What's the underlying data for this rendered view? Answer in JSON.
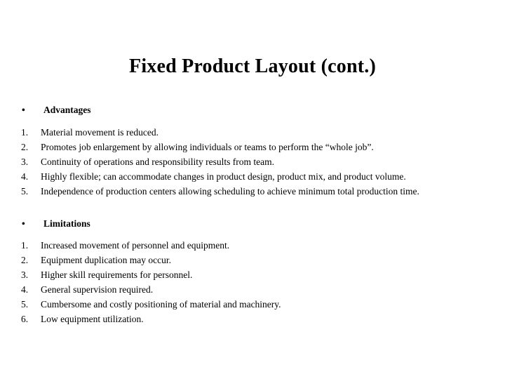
{
  "slide": {
    "title": "Fixed Product Layout (cont.)",
    "bullet_glyph": "•",
    "sections": [
      {
        "heading": "Advantages",
        "items": [
          {
            "number": "1.",
            "text": "Material movement is reduced."
          },
          {
            "number": "2.",
            "text": "Promotes job enlargement by allowing individuals or teams to perform the “whole job”."
          },
          {
            "number": "3.",
            "text": "Continuity of operations and responsibility results from team."
          },
          {
            "number": "4.",
            "text": "Highly flexible; can accommodate changes in product design, product mix, and product volume."
          },
          {
            "number": "5.",
            "text": "Independence of production centers allowing scheduling to achieve minimum total production time."
          }
        ]
      },
      {
        "heading": "Limitations",
        "items": [
          {
            "number": "1.",
            "text": "Increased movement of personnel and equipment."
          },
          {
            "number": "2.",
            "text": "Equipment duplication may occur."
          },
          {
            "number": "3.",
            "text": "Higher skill requirements for personnel."
          },
          {
            "number": "4.",
            "text": "General supervision required."
          },
          {
            "number": "5.",
            "text": "Cumbersome and costly positioning of material and machinery."
          },
          {
            "number": "6.",
            "text": "Low equipment utilization."
          }
        ]
      }
    ],
    "colors": {
      "background": "#ffffff",
      "text": "#000000"
    }
  }
}
